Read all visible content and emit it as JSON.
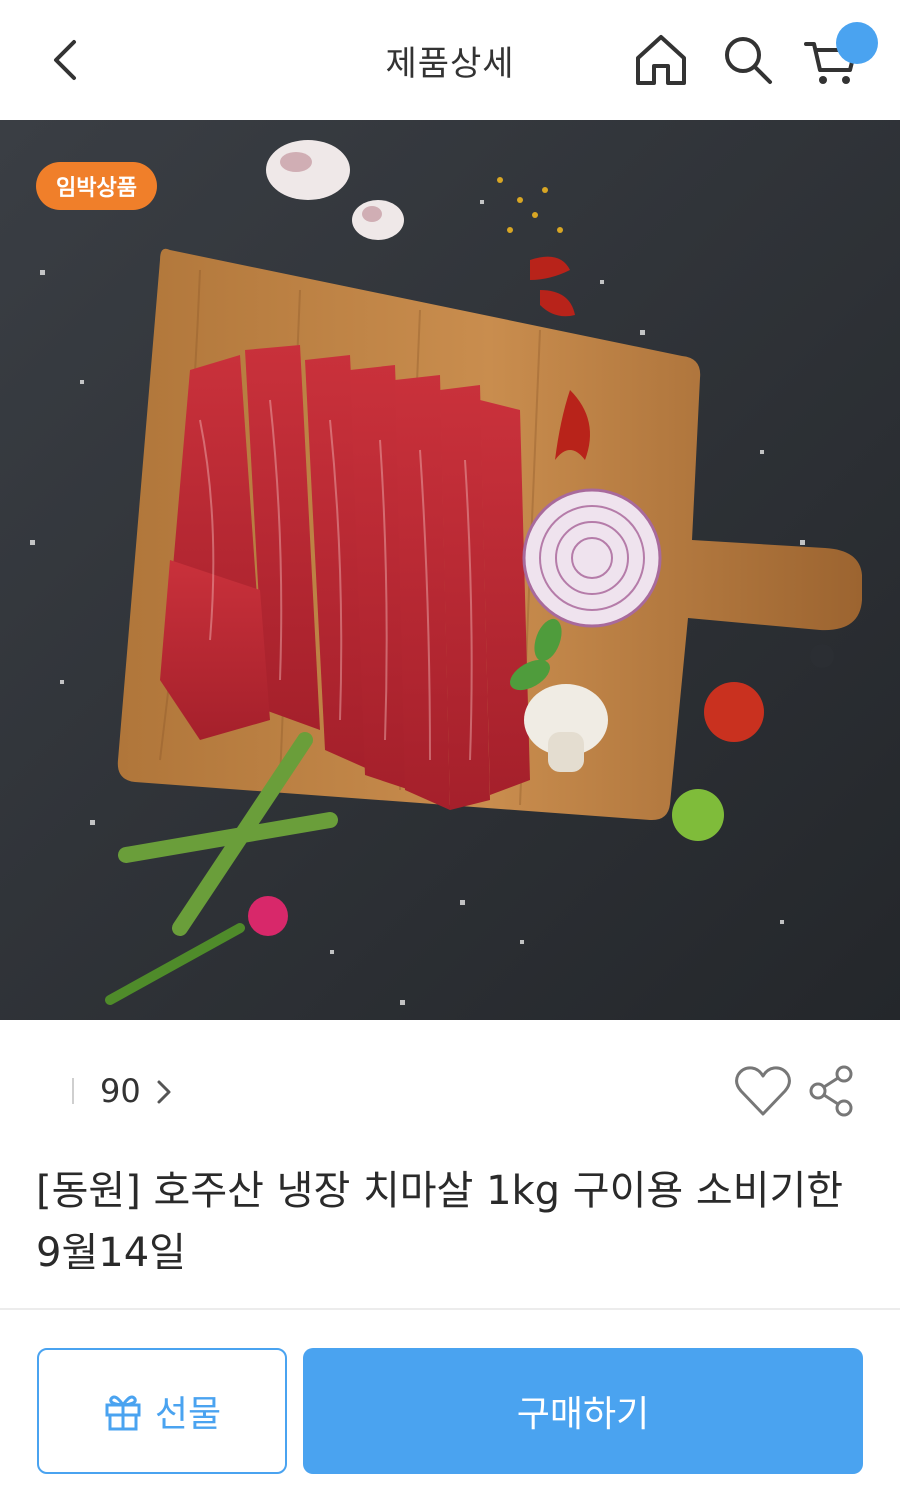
{
  "header": {
    "title": "제품상세",
    "icons": [
      "back-icon",
      "home-icon",
      "search-icon",
      "cart-icon"
    ]
  },
  "hero": {
    "badge": "임박상품"
  },
  "meta": {
    "review_count": "90"
  },
  "product": {
    "title": "[동원] 호주산 냉장 치마살 1kg 구이용 소비기한 9월14일"
  },
  "actions": {
    "gift_label": "선물",
    "buy_label": "구매하기"
  },
  "colors": {
    "accent": "#4aa3f0",
    "badge": "#f07f2a"
  }
}
